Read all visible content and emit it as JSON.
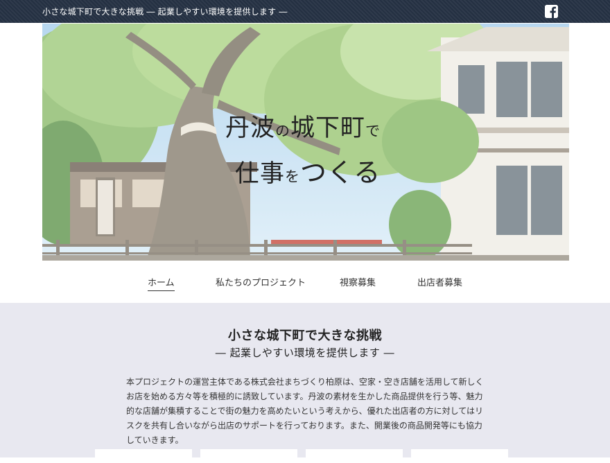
{
  "topbar": {
    "title": "小さな城下町で大きな挑戦 ― 起業しやすい環境を提供します ―",
    "social_icon": "facebook-icon",
    "background_color": "#243042"
  },
  "hero": {
    "line1_big_a": "丹波",
    "line1_small_a": "の",
    "line1_big_b": "城下町",
    "line1_small_b": "で",
    "line2_big_a": "仕事",
    "line2_small_a": "を",
    "line2_big_b": "つくる"
  },
  "nav": {
    "items": [
      {
        "label": "ホーム",
        "active": true
      },
      {
        "label": "私たちのプロジェクト",
        "active": false
      },
      {
        "label": "視察募集",
        "active": false
      },
      {
        "label": "出店者募集",
        "active": false
      }
    ]
  },
  "intro": {
    "heading": "小さな城下町で大きな挑戦",
    "subheading": "― 起業しやすい環境を提供します ―",
    "paragraph": "本プロジェクトの運営主体である株式会社まちづくり柏原は、空家・空き店舗を活用して新しくお店を始める方々等を積極的に誘致しています。丹波の素材を生かした商品提供を行う等、魅力的な店舗が集積することで街の魅力を高めたいという考えから、優れた出店者の方に対してはリスクを共有し合いながら出店のサポートを行っております。また、開業後の商品開発等にも協力していきます。",
    "background_color": "#e8e8f0"
  }
}
